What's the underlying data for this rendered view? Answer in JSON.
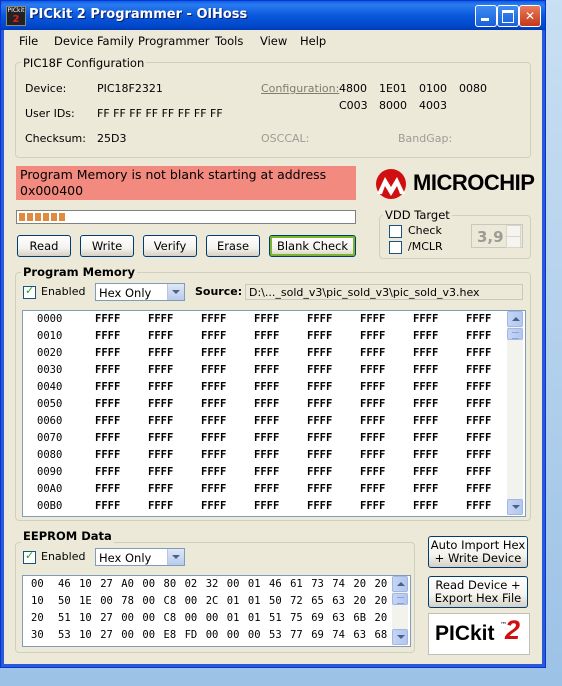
{
  "window": {
    "title": "PICkit 2 Programmer - OlHoss",
    "icon_text": "PICkit",
    "icon_number": "2"
  },
  "menu": [
    "File",
    "Device Family",
    "Programmer",
    "Tools",
    "View",
    "Help"
  ],
  "config": {
    "group_label": "PIC18F Configuration",
    "device_label": "Device:",
    "device_value": "PIC18F2321",
    "user_ids_label": "User IDs:",
    "user_ids_value": "FF FF FF FF FF FF FF FF",
    "checksum_label": "Checksum:",
    "checksum_value": "25D3",
    "configuration_label": "Configuration:",
    "configuration_words": [
      "4800",
      "1E01",
      "0100",
      "0080",
      "C003",
      "8000",
      "4003"
    ],
    "osccal_label": "OSCCAL:",
    "bandgap_label": "BandGap:"
  },
  "status": {
    "message": "Program Memory is not blank starting at address 0x000400",
    "progress_fraction": 0.14,
    "colors": {
      "status_bg": "#f28a80",
      "progress_fill": "#e08a3d"
    }
  },
  "logo": {
    "word": "MICROCHIP",
    "colors": {
      "mark": "#d01010"
    }
  },
  "buttons": {
    "read": "Read",
    "write": "Write",
    "verify": "Verify",
    "erase": "Erase",
    "blank_check": "Blank Check"
  },
  "vdd": {
    "group_label": "VDD Target",
    "check_label": "Check",
    "mclr_label": "/MCLR",
    "voltage": "3,9"
  },
  "program_memory": {
    "group_label": "Program Memory",
    "enabled_label": "Enabled",
    "mode": "Hex Only",
    "source_label": "Source:",
    "source_path": "D:\\..._sold_v3\\pic_sold_v3\\pic_sold_v3.hex",
    "rows": [
      {
        "addr": "0000",
        "words": [
          "FFFF",
          "FFFF",
          "FFFF",
          "FFFF",
          "FFFF",
          "FFFF",
          "FFFF",
          "FFFF"
        ]
      },
      {
        "addr": "0010",
        "words": [
          "FFFF",
          "FFFF",
          "FFFF",
          "FFFF",
          "FFFF",
          "FFFF",
          "FFFF",
          "FFFF"
        ]
      },
      {
        "addr": "0020",
        "words": [
          "FFFF",
          "FFFF",
          "FFFF",
          "FFFF",
          "FFFF",
          "FFFF",
          "FFFF",
          "FFFF"
        ]
      },
      {
        "addr": "0030",
        "words": [
          "FFFF",
          "FFFF",
          "FFFF",
          "FFFF",
          "FFFF",
          "FFFF",
          "FFFF",
          "FFFF"
        ]
      },
      {
        "addr": "0040",
        "words": [
          "FFFF",
          "FFFF",
          "FFFF",
          "FFFF",
          "FFFF",
          "FFFF",
          "FFFF",
          "FFFF"
        ]
      },
      {
        "addr": "0050",
        "words": [
          "FFFF",
          "FFFF",
          "FFFF",
          "FFFF",
          "FFFF",
          "FFFF",
          "FFFF",
          "FFFF"
        ]
      },
      {
        "addr": "0060",
        "words": [
          "FFFF",
          "FFFF",
          "FFFF",
          "FFFF",
          "FFFF",
          "FFFF",
          "FFFF",
          "FFFF"
        ]
      },
      {
        "addr": "0070",
        "words": [
          "FFFF",
          "FFFF",
          "FFFF",
          "FFFF",
          "FFFF",
          "FFFF",
          "FFFF",
          "FFFF"
        ]
      },
      {
        "addr": "0080",
        "words": [
          "FFFF",
          "FFFF",
          "FFFF",
          "FFFF",
          "FFFF",
          "FFFF",
          "FFFF",
          "FFFF"
        ]
      },
      {
        "addr": "0090",
        "words": [
          "FFFF",
          "FFFF",
          "FFFF",
          "FFFF",
          "FFFF",
          "FFFF",
          "FFFF",
          "FFFF"
        ]
      },
      {
        "addr": "00A0",
        "words": [
          "FFFF",
          "FFFF",
          "FFFF",
          "FFFF",
          "FFFF",
          "FFFF",
          "FFFF",
          "FFFF"
        ]
      },
      {
        "addr": "00B0",
        "words": [
          "FFFF",
          "FFFF",
          "FFFF",
          "FFFF",
          "FFFF",
          "FFFF",
          "FFFF",
          "FFFF"
        ]
      }
    ]
  },
  "eeprom": {
    "group_label": "EEPROM Data",
    "enabled_label": "Enabled",
    "mode": "Hex Only",
    "rows": [
      {
        "addr": "00",
        "bytes": [
          "46",
          "10",
          "27",
          "A0",
          "00",
          "80",
          "02",
          "32",
          "00",
          "01",
          "46",
          "61",
          "73",
          "74",
          "20",
          "20"
        ]
      },
      {
        "addr": "10",
        "bytes": [
          "50",
          "1E",
          "00",
          "78",
          "00",
          "C8",
          "00",
          "2C",
          "01",
          "01",
          "50",
          "72",
          "65",
          "63",
          "20",
          "20"
        ]
      },
      {
        "addr": "20",
        "bytes": [
          "51",
          "10",
          "27",
          "00",
          "00",
          "C8",
          "00",
          "00",
          "01",
          "01",
          "51",
          "75",
          "69",
          "63",
          "6B",
          "20"
        ]
      },
      {
        "addr": "30",
        "bytes": [
          "53",
          "10",
          "27",
          "00",
          "00",
          "E8",
          "FD",
          "00",
          "00",
          "00",
          "53",
          "77",
          "69",
          "74",
          "63",
          "68"
        ]
      }
    ]
  },
  "side_buttons": {
    "auto_import": [
      "Auto Import Hex",
      "+ Write Device"
    ],
    "read_export": [
      "Read Device +",
      "Export Hex File"
    ]
  },
  "pickit_logo": {
    "text": "PICkit",
    "tm": "™",
    "number": "2"
  }
}
